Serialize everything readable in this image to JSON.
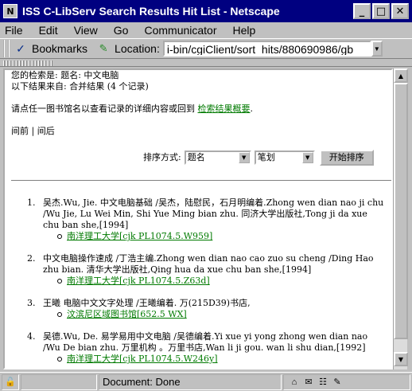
{
  "window": {
    "title": "ISS C-LibServ Search Results Hit List - Netscape",
    "minimize_glyph": "_",
    "maximize_glyph": "□",
    "close_glyph": "✕"
  },
  "menu": [
    "File",
    "Edit",
    "View",
    "Go",
    "Communicator",
    "Help"
  ],
  "toolbar": {
    "bookmarks_label": "Bookmarks",
    "location_label": "Location:",
    "location_value": "i-bin/cgiClient/sort_hits/880690986/gb"
  },
  "content": {
    "query_line": "您的检索是: 题名: 中文电脑",
    "source_line": "以下结果来自: 合并结果 (4 个记录)",
    "instruction_text": "请点任一图书馆名以查看记录的详细内容或回到",
    "summary_link": "检索结果概要",
    "period": ".",
    "nav_prev": "间前",
    "nav_sep": "|",
    "nav_next": "间后",
    "sort_label": "排序方式:",
    "sort_field": "题名",
    "sort_order": "笔划",
    "sort_button": "开始排序"
  },
  "results": [
    {
      "num": "1.",
      "text": "吴杰.Wu, Jie. 中文电脑基础 /吴杰，陆慰民，石月明编着.Zhong wen dian nao ji chu /Wu Jie, Lu Wei Min, Shi Yue Ming bian zhu. 同济大学出版社,Tong ji da xue chu ban she,[1994]",
      "holding": "南洋理工大学[cjk PL1074.5.W959]"
    },
    {
      "num": "2.",
      "text": "中文电脑操作速成 /丁浩主编.Zhong wen dian nao cao zuo su cheng /Ding Hao zhu bian. 清华大学出版社,Qing hua da xue chu ban she,[1994]",
      "holding": "南洋理工大学[cjk PL1074.5.Z63d]"
    },
    {
      "num": "3.",
      "text": "王曦 电脑中文文字处理 /王曦编着. 万(215D39)书店,",
      "holding": "汶滨尼区域图书馆[652.5 WX]"
    },
    {
      "num": "4.",
      "text": "吴德.Wu, De. 易学易用中文电脑 /吴德编着.Yi xue yi yong zhong wen dian nao /Wu De bian zhu. 万里机构 。万里书店,Wan li ji gou. wan li shu dian,[1992]",
      "holding": "南洋理工大学[cjk PL1074.5.W246y]"
    }
  ],
  "status": {
    "text": "Document: Done"
  },
  "colors": {
    "titlebar": "#000080",
    "link": "#007a00",
    "chrome": "#c0c0c0"
  }
}
